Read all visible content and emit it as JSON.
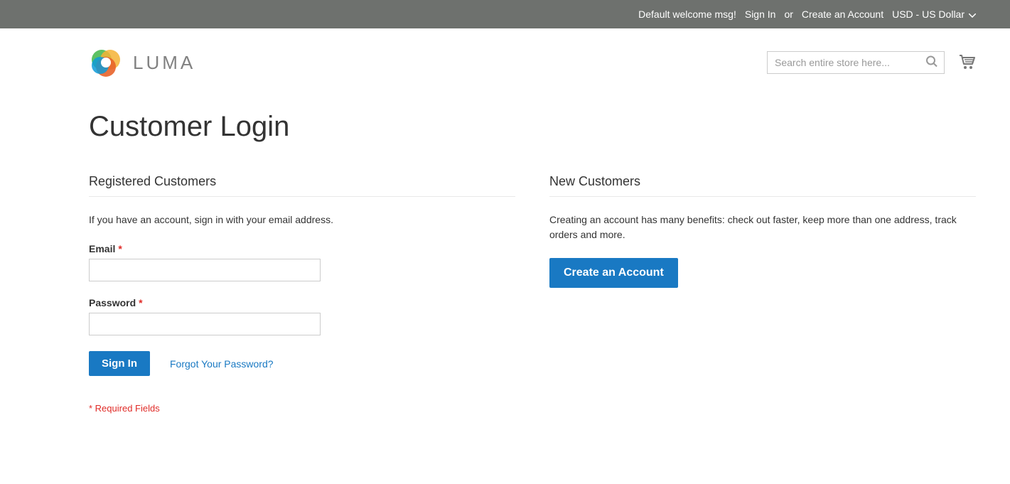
{
  "topbar": {
    "welcome": "Default welcome msg!",
    "signin": "Sign In",
    "or": "or",
    "create": "Create an Account",
    "currency": "USD - US Dollar"
  },
  "logo": {
    "text": "LUMA"
  },
  "search": {
    "placeholder": "Search entire store here..."
  },
  "page": {
    "title": "Customer Login"
  },
  "login": {
    "heading": "Registered Customers",
    "desc": "If you have an account, sign in with your email address.",
    "email_label": "Email",
    "password_label": "Password",
    "signin_btn": "Sign In",
    "forgot": "Forgot Your Password?",
    "required_note": "* Required Fields"
  },
  "new": {
    "heading": "New Customers",
    "desc": "Creating an account has many benefits: check out faster, keep more than one address, track orders and more.",
    "create_btn": "Create an Account"
  }
}
